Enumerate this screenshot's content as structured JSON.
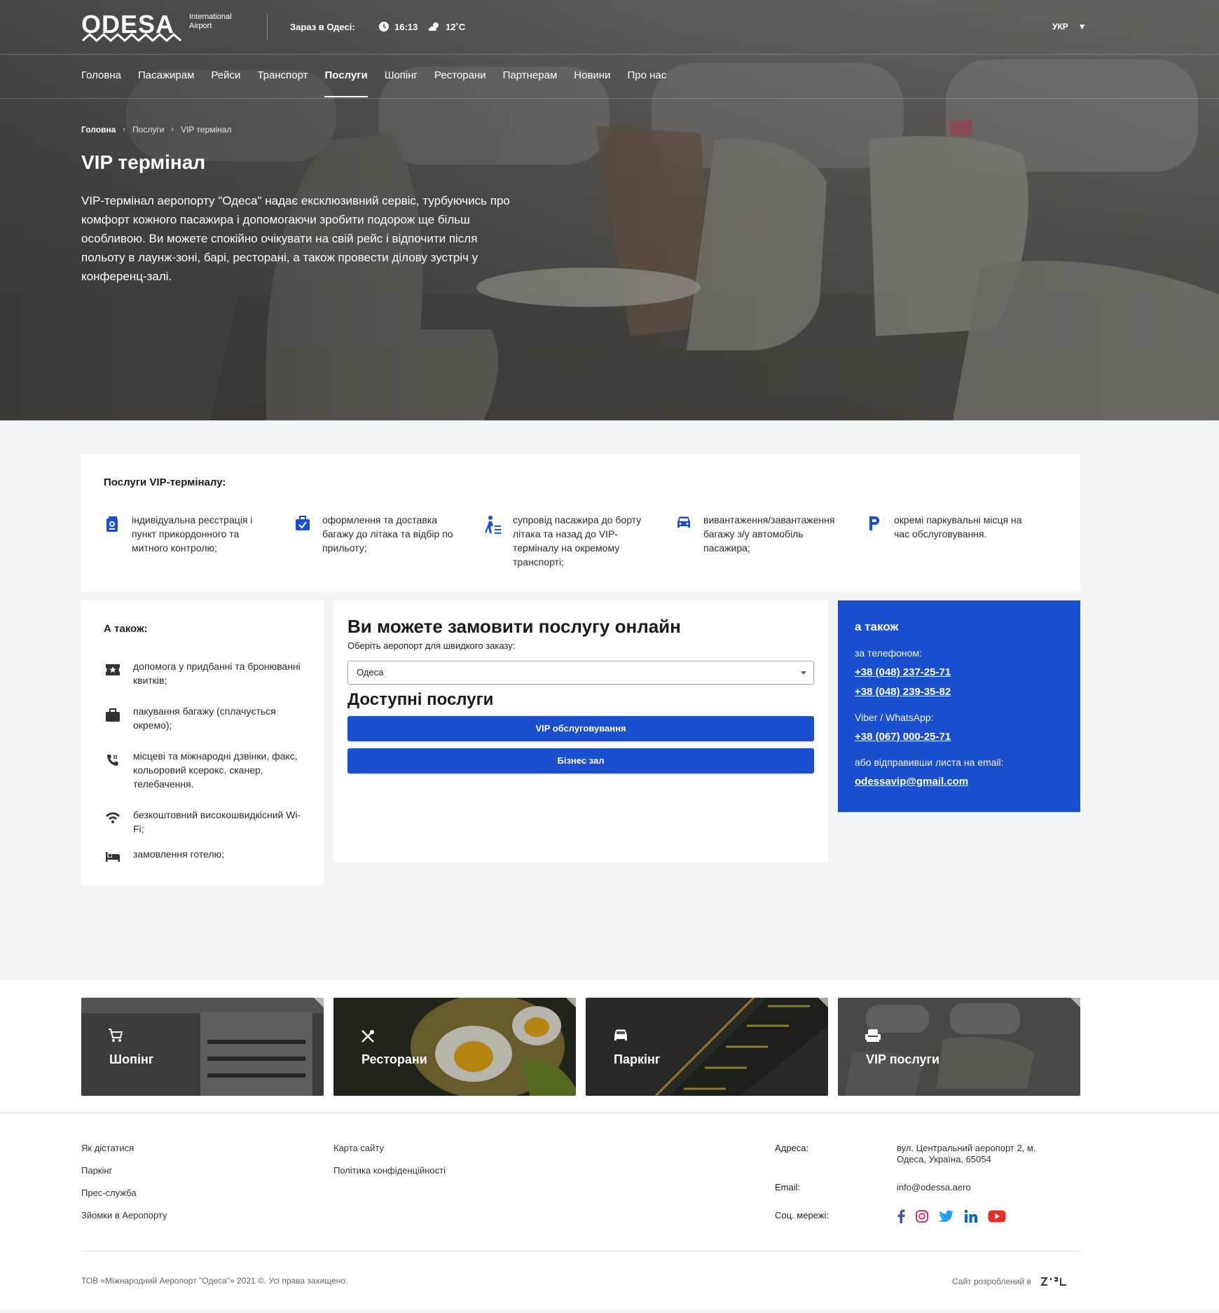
{
  "header": {
    "logo_word": "ODESA",
    "logo_sub": "International Airport",
    "now_label": "Зараз в Одесі:",
    "time": "16:13",
    "temperature": "12˚C",
    "language": "УКР",
    "nav": [
      "Головна",
      "Пасажирам",
      "Рейси",
      "Транспорт",
      "Послуги",
      "Шопінг",
      "Ресторани",
      "Партнерам",
      "Новини",
      "Про нас"
    ],
    "nav_active": "Послуги"
  },
  "breadcrumb": [
    "Головна",
    "Послуги",
    "VIP термінал"
  ],
  "hero": {
    "title": "VIP термінал",
    "intro": "VIP-термінал аеропорту \"Одеса\" надає ексклюзивний сервіс, турбуючись про комфорт кожного пасажира і допомогаючи зробити подорож ще більш особливою. Ви можете спокійно очікувати на свій рейс і відпочити після польоту в лаунж-зоні, барі, ресторані, а також провести ділову зустріч у конференц-залі."
  },
  "services": {
    "title": "Послуги VIP-терміналу:",
    "items": [
      {
        "icon": "passport-icon",
        "text": "індивідуальна реєстрація і пункт прикордонного та митного контролю;"
      },
      {
        "icon": "luggage-check-icon",
        "text": "оформлення та доставка багажу до літака та відбір по прильоту;"
      },
      {
        "icon": "escort-icon",
        "text": "супровід пасажира до борту літака та назад до VIP-терміналу на окремому транспорті;"
      },
      {
        "icon": "car-icon",
        "text": "вивантаження/завантаження багажу з/у автомобіль пасажира;"
      },
      {
        "icon": "parking-icon",
        "text": "окремі паркувальні місця на час обслуговування."
      }
    ]
  },
  "also": {
    "title": "А також:",
    "items": [
      {
        "icon": "ticket-icon",
        "text": "допомога у придбанні та бронюванні квитків;"
      },
      {
        "icon": "suitcase-icon",
        "text": "пакування багажу (сплачується окремо);"
      },
      {
        "icon": "phone-icon",
        "text": "місцеві та міжнародні дзвінки, факс, кольоровий ксерокс, сканер, телебачення."
      },
      {
        "icon": "wifi-icon",
        "text": "безкоштовний високошвидкісний Wi-Fi;"
      },
      {
        "icon": "hotel-bed-icon",
        "text": "замовлення готелю;"
      }
    ]
  },
  "order": {
    "title": "Ви можете замовити послугу онлайн",
    "subtitle": "Оберіть аеропорт для швидкого заказу:",
    "airport_selected": "Одеса",
    "available_title": "Доступні послуги",
    "buttons": [
      "VIP обслуговування",
      "Бізнес зал"
    ]
  },
  "contacts": {
    "title": "а також",
    "phone_label": "за телефоном:",
    "phones": [
      "+38 (048) 237-25-71",
      "+38 (048) 239-35-82"
    ],
    "viber_label": "Viber / WhatsApp:",
    "viber": "+38 (067) 000-25-71",
    "email_label": "або відправивши листа на email:",
    "email": "odessavip@gmail.com"
  },
  "tiles": [
    {
      "label": "Шопінг",
      "icon": "cart-icon"
    },
    {
      "label": "Ресторани",
      "icon": "cutlery-icon"
    },
    {
      "label": "Паркінг",
      "icon": "car-icon"
    },
    {
      "label": "VIP послуги",
      "icon": "lounge-chair-icon"
    }
  ],
  "footer": {
    "col1": [
      "Як дістатися",
      "Паркінг",
      "Прес-служба",
      "Зйомки в Аеропорту"
    ],
    "col2": [
      "Карта сайту",
      "Політика конфіденційності"
    ],
    "address_label": "Адреса:",
    "address": "вул. Центральний аеропорт 2, м. Одеса, Україна, 65054",
    "email_label": "Email:",
    "email": "info@odessa.aero",
    "social_label": "Соц. мережі:",
    "socials": [
      "facebook-icon",
      "instagram-icon",
      "twitter-icon",
      "linkedin-icon",
      "youtube-icon"
    ],
    "copyright": "ТОВ «Міжнародний Аеропорт \"Одеса\"» 2021 ©. Усі права захищено.",
    "made_by": "Сайт розроблений в"
  },
  "colors": {
    "accent": "#1a4fd0",
    "page_bg": "#f3f4f6",
    "youtube": "#e52d27",
    "facebook": "#3b5998",
    "twitter": "#1da1f2",
    "linkedin": "#0a66c2"
  }
}
